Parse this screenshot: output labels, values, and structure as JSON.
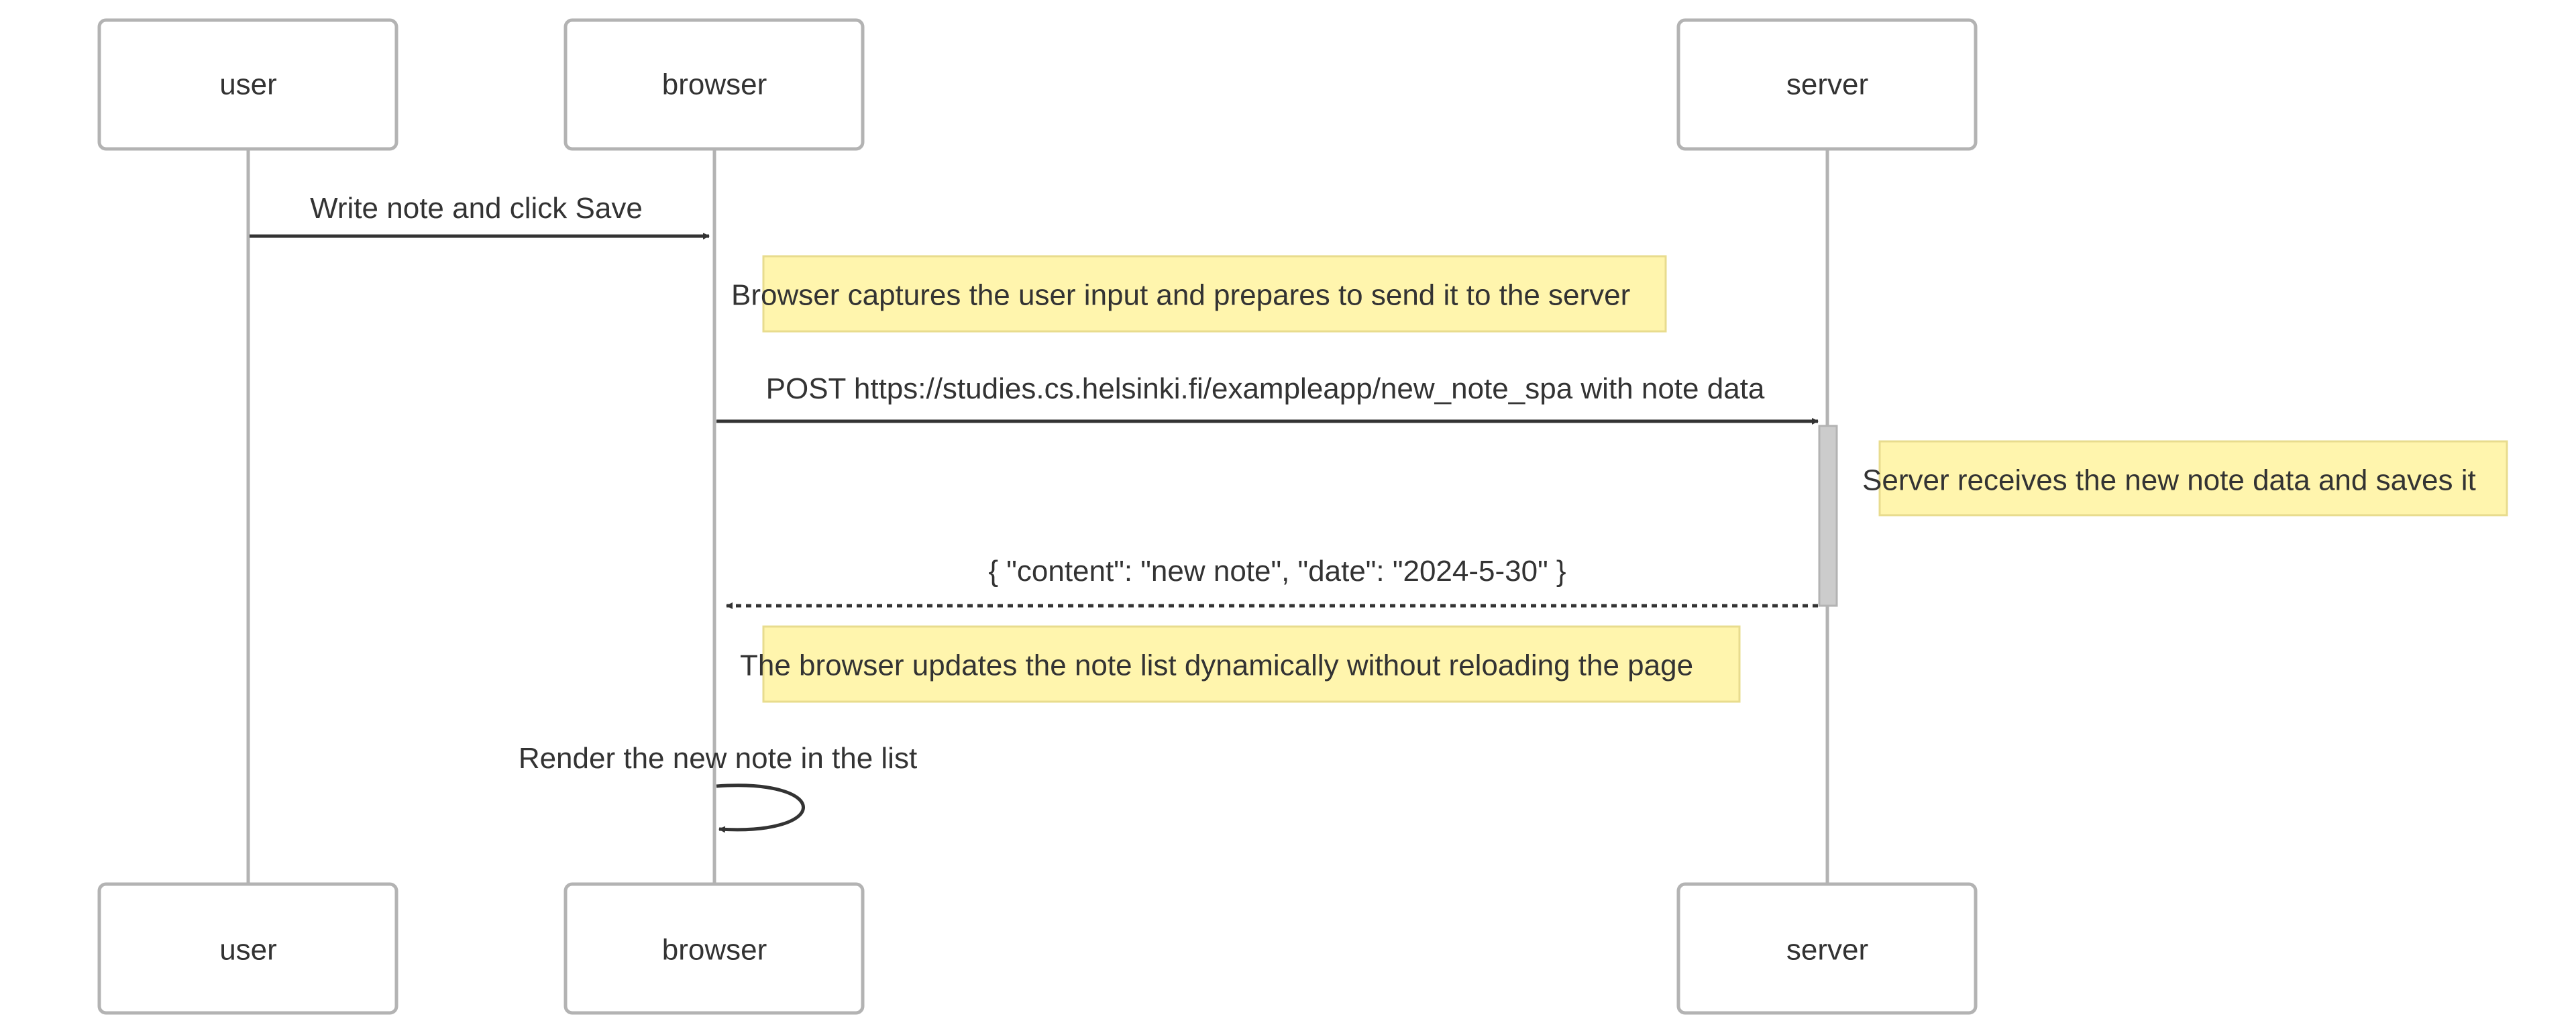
{
  "participants": [
    {
      "id": "user",
      "label": "user"
    },
    {
      "id": "browser",
      "label": "browser"
    },
    {
      "id": "server",
      "label": "server"
    }
  ],
  "messages": [
    {
      "from": "user",
      "to": "browser",
      "text": "Write note and click Save",
      "style": "solid"
    },
    {
      "from": "browser",
      "to": "server",
      "text": "POST https://studies.cs.helsinki.fi/exampleapp/new_note_spa with note data",
      "style": "solid"
    },
    {
      "from": "server",
      "to": "browser",
      "text": "{ \"content\": \"new note\", \"date\": \"2024-5-30\" }",
      "style": "dashed"
    },
    {
      "from": "browser",
      "to": "browser",
      "text": "Render the new note in the list",
      "style": "solid"
    }
  ],
  "notes": [
    {
      "over": "browser",
      "text": "Browser captures the user input and prepares to send it to the server"
    },
    {
      "over": "server",
      "text": "Server receives the new note data and saves it"
    },
    {
      "over": "browser",
      "text": "The browser updates the note list dynamically without reloading the page"
    }
  ],
  "colors": {
    "note_fill": "#fff5ad",
    "note_border": "#e8dc8e",
    "actor_border": "#b3b3b3",
    "text": "#333333",
    "activation": "#cccccc"
  }
}
